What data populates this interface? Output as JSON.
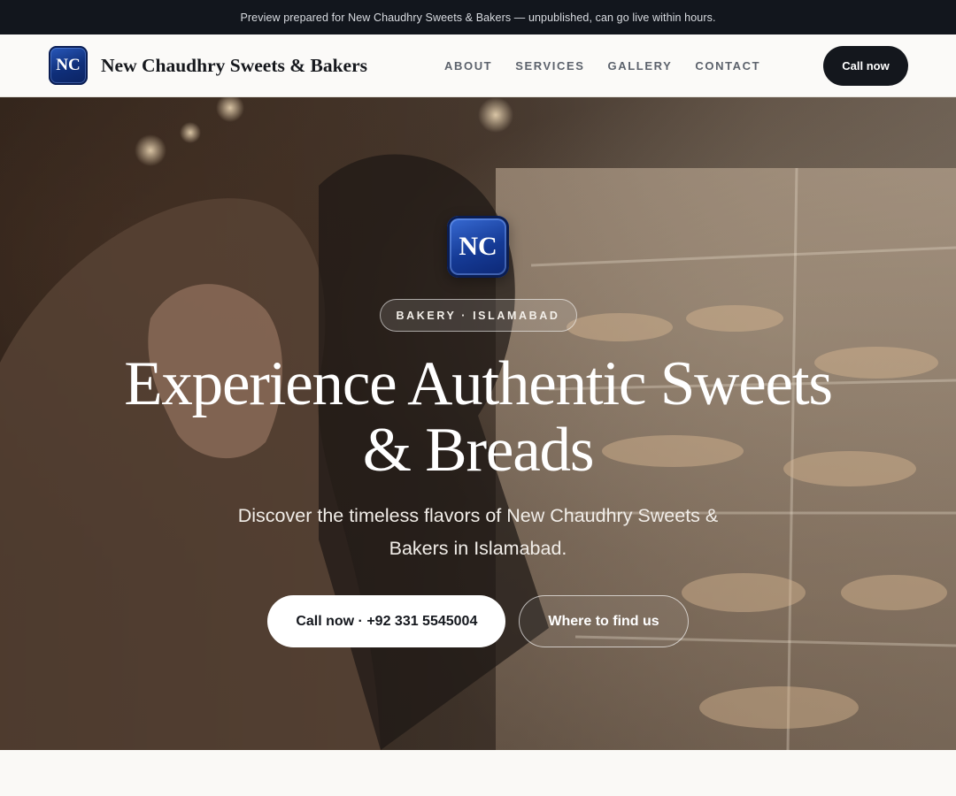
{
  "preview_banner": "Preview prepared for New Chaudhry Sweets & Bakers — unpublished, can go live within hours.",
  "brand": {
    "logo_text": "NC",
    "name": "New Chaudhry Sweets & Bakers",
    "logo_color": "#153a95"
  },
  "nav": {
    "items": [
      "ABOUT",
      "SERVICES",
      "GALLERY",
      "CONTACT"
    ],
    "cta_label": "Call now"
  },
  "hero": {
    "logo_text": "NC",
    "badge": "BAKERY · ISLAMABAD",
    "headline": "Experience Authentic Sweets & Breads",
    "subhead": "Discover the timeless flavors of New Chaudhry Sweets & Bakers in Islamabad.",
    "primary_button": "Call now · +92 331 5545004",
    "secondary_button": "Where to find us",
    "background_image": "bakery-display-photo"
  },
  "colors": {
    "topbar_bg": "#12161d",
    "header_bg": "#fbfaf8",
    "accent_dark": "#14171d",
    "page_bg": "#faf9f6"
  }
}
